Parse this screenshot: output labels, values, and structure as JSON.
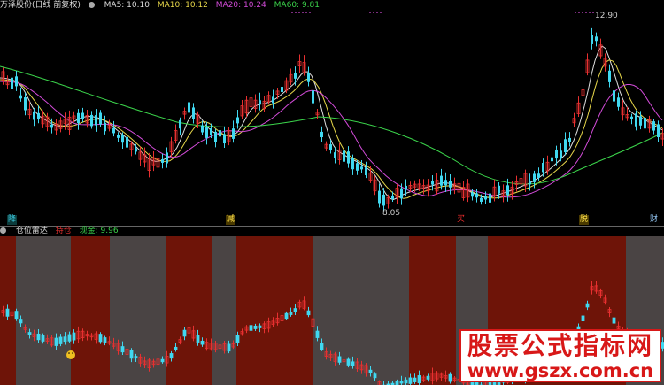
{
  "header": {
    "title": "万泽股份(日线 前复权)",
    "ma5": "MA5: 10.10",
    "ma10": "MA10: 10.12",
    "ma20": "MA20: 10.24",
    "ma60": "MA60: 9.81"
  },
  "main_chart": {
    "high_label": "12.90",
    "low_label": "8.05",
    "markers": [
      "降",
      "减",
      "买",
      "脱",
      "财"
    ]
  },
  "sub_panel": {
    "name": "仓位雷达",
    "hold_label": "持仓",
    "cash_label": "现金: 9.96"
  },
  "watermark": {
    "title": "股票公式指标网",
    "url": "www.gszx.com.cn"
  },
  "colors": {
    "hold_band": "#6e1408",
    "cash_band": "#4a4444",
    "candle_up": "#e83030",
    "candle_down": "#40d8f0",
    "ma5": "#e0e0e0",
    "ma10": "#e8d84a",
    "ma20": "#d24bd8",
    "ma60": "#3bd44b"
  }
}
